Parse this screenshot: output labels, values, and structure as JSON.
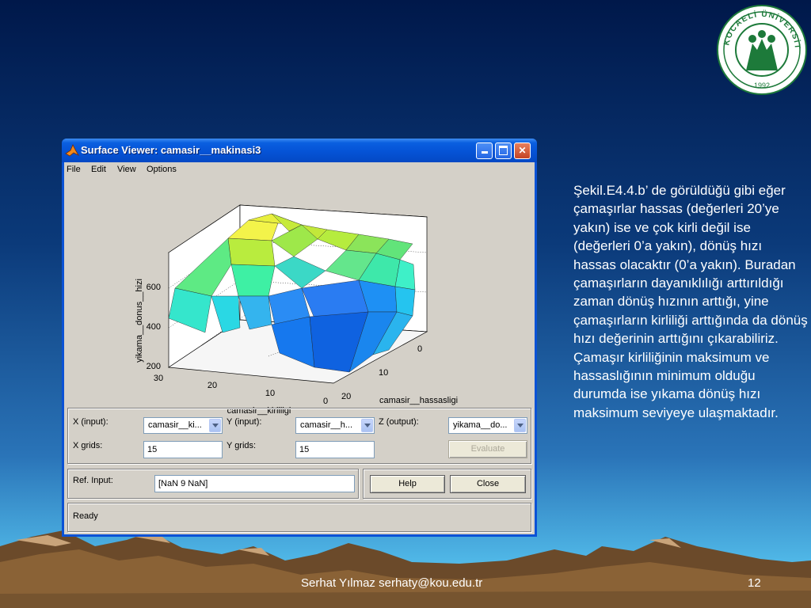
{
  "slide": {
    "body_text": "Şekil.E4.4.b’ de görüldüğü gibi eğer çamaşırlar hassas (değerleri 20’ye yakın) ise ve çok kirli değil ise (değerleri 0’a yakın), dönüş hızı hassas olacaktır (0’a yakın). Buradan çamaşırların dayanıklılığı arttırıldığı zaman dönüş hızının arttığı, yine çamaşırların kirliliği arttığında da dönüş hızı değerinin arttığını çıkarabiliriz. Çamaşır kirliliğinin maksimum ve hassaslığının minimum olduğu durumda ise yıkama dönüş hızı maksimum seviyeye ulaşmaktadır.",
    "footer_author": "Serhat Yılmaz serhaty@kou.edu.tr",
    "page_number": "12",
    "seal_text": "KOCAELİ ÜNİVERSİTESİ",
    "seal_year": "1992"
  },
  "window": {
    "title": "Surface Viewer: camasir__makinasi3",
    "menu": [
      "File",
      "Edit",
      "View",
      "Options"
    ],
    "controls": {
      "minimize_icon": "minimize-icon",
      "maximize_icon": "maximize-icon",
      "close_icon": "close-icon"
    }
  },
  "plot": {
    "z_label": "yikama__donus__hizi",
    "x_label": "camasir__kirliligi",
    "y_label": "camasir__hassasligi",
    "z_ticks": [
      "200",
      "400",
      "600"
    ],
    "x_ticks": [
      "30",
      "20",
      "10",
      "0"
    ],
    "y_ticks": [
      "0",
      "10",
      "20"
    ]
  },
  "controls": {
    "x_input_label": "X (input):",
    "x_input_value": "camasir__ki...",
    "y_input_label": "Y (input):",
    "y_input_value": "camasir__h...",
    "z_output_label": "Z (output):",
    "z_output_value": "yikama__do...",
    "x_grids_label": "X grids:",
    "x_grids_value": "15",
    "y_grids_label": "Y grids:",
    "y_grids_value": "15",
    "evaluate_label": "Evaluate",
    "ref_input_label": "Ref. Input:",
    "ref_input_value": "[NaN 9 NaN]",
    "help_label": "Help",
    "close_label": "Close",
    "status_text": "Ready"
  },
  "colors": {
    "title_bar": "#0553d6",
    "dialog_face": "#d4d0c8",
    "slide_background": "#00184a"
  }
}
